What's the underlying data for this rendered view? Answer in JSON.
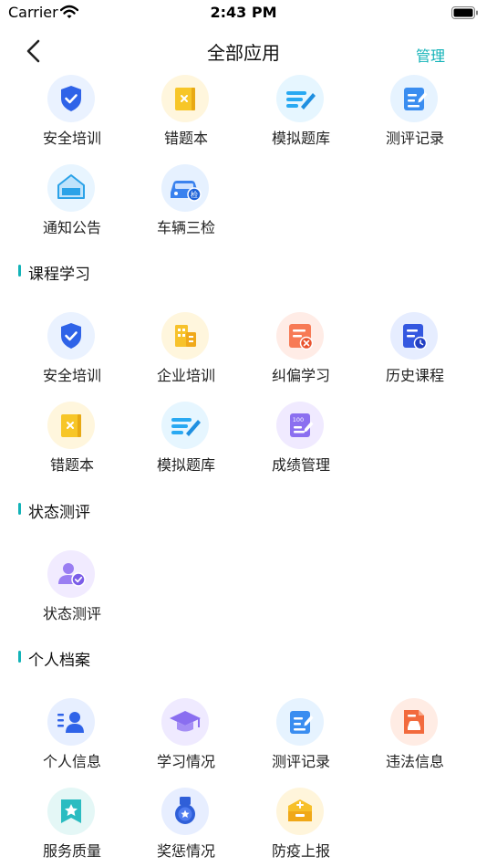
{
  "status": {
    "carrier": "Carrier",
    "time": "2:43 PM"
  },
  "nav": {
    "title": "全部应用",
    "manage": "管理"
  },
  "top": {
    "row1": [
      "安全培训",
      "错题本",
      "模拟题库",
      "测评记录"
    ],
    "row2": [
      "通知公告",
      "车辆三检"
    ]
  },
  "course": {
    "title": "课程学习",
    "row1": [
      "安全培训",
      "企业培训",
      "纠偏学习",
      "历史课程"
    ],
    "row2": [
      "错题本",
      "模拟题库",
      "成绩管理"
    ]
  },
  "state": {
    "title": "状态测评",
    "row1": [
      "状态测评"
    ]
  },
  "profile": {
    "title": "个人档案",
    "row1": [
      "个人信息",
      "学习情况",
      "测评记录",
      "违法信息"
    ],
    "row2": [
      "服务质量",
      "奖惩情况",
      "防疫上报"
    ]
  },
  "icons": {
    "top": {
      "row1": [
        "shield-check-icon",
        "wrong-book-icon",
        "question-bank-icon",
        "evaluation-record-icon"
      ],
      "row2": [
        "notice-board-icon",
        "vehicle-inspection-icon"
      ]
    },
    "course": {
      "row1": [
        "shield-check-icon",
        "company-building-icon",
        "correction-doc-icon",
        "history-course-icon"
      ],
      "row2": [
        "wrong-book-icon",
        "question-bank-icon",
        "score-sheet-icon"
      ]
    },
    "state": {
      "row1": [
        "user-check-icon"
      ]
    },
    "profile": {
      "row1": [
        "user-info-icon",
        "graduation-cap-icon",
        "evaluation-record-icon",
        "violation-car-icon"
      ],
      "row2": [
        "service-star-icon",
        "medal-icon",
        "epidemic-box-icon"
      ]
    }
  },
  "colors": {
    "accent": "#13b3b8",
    "text": "#222222"
  }
}
